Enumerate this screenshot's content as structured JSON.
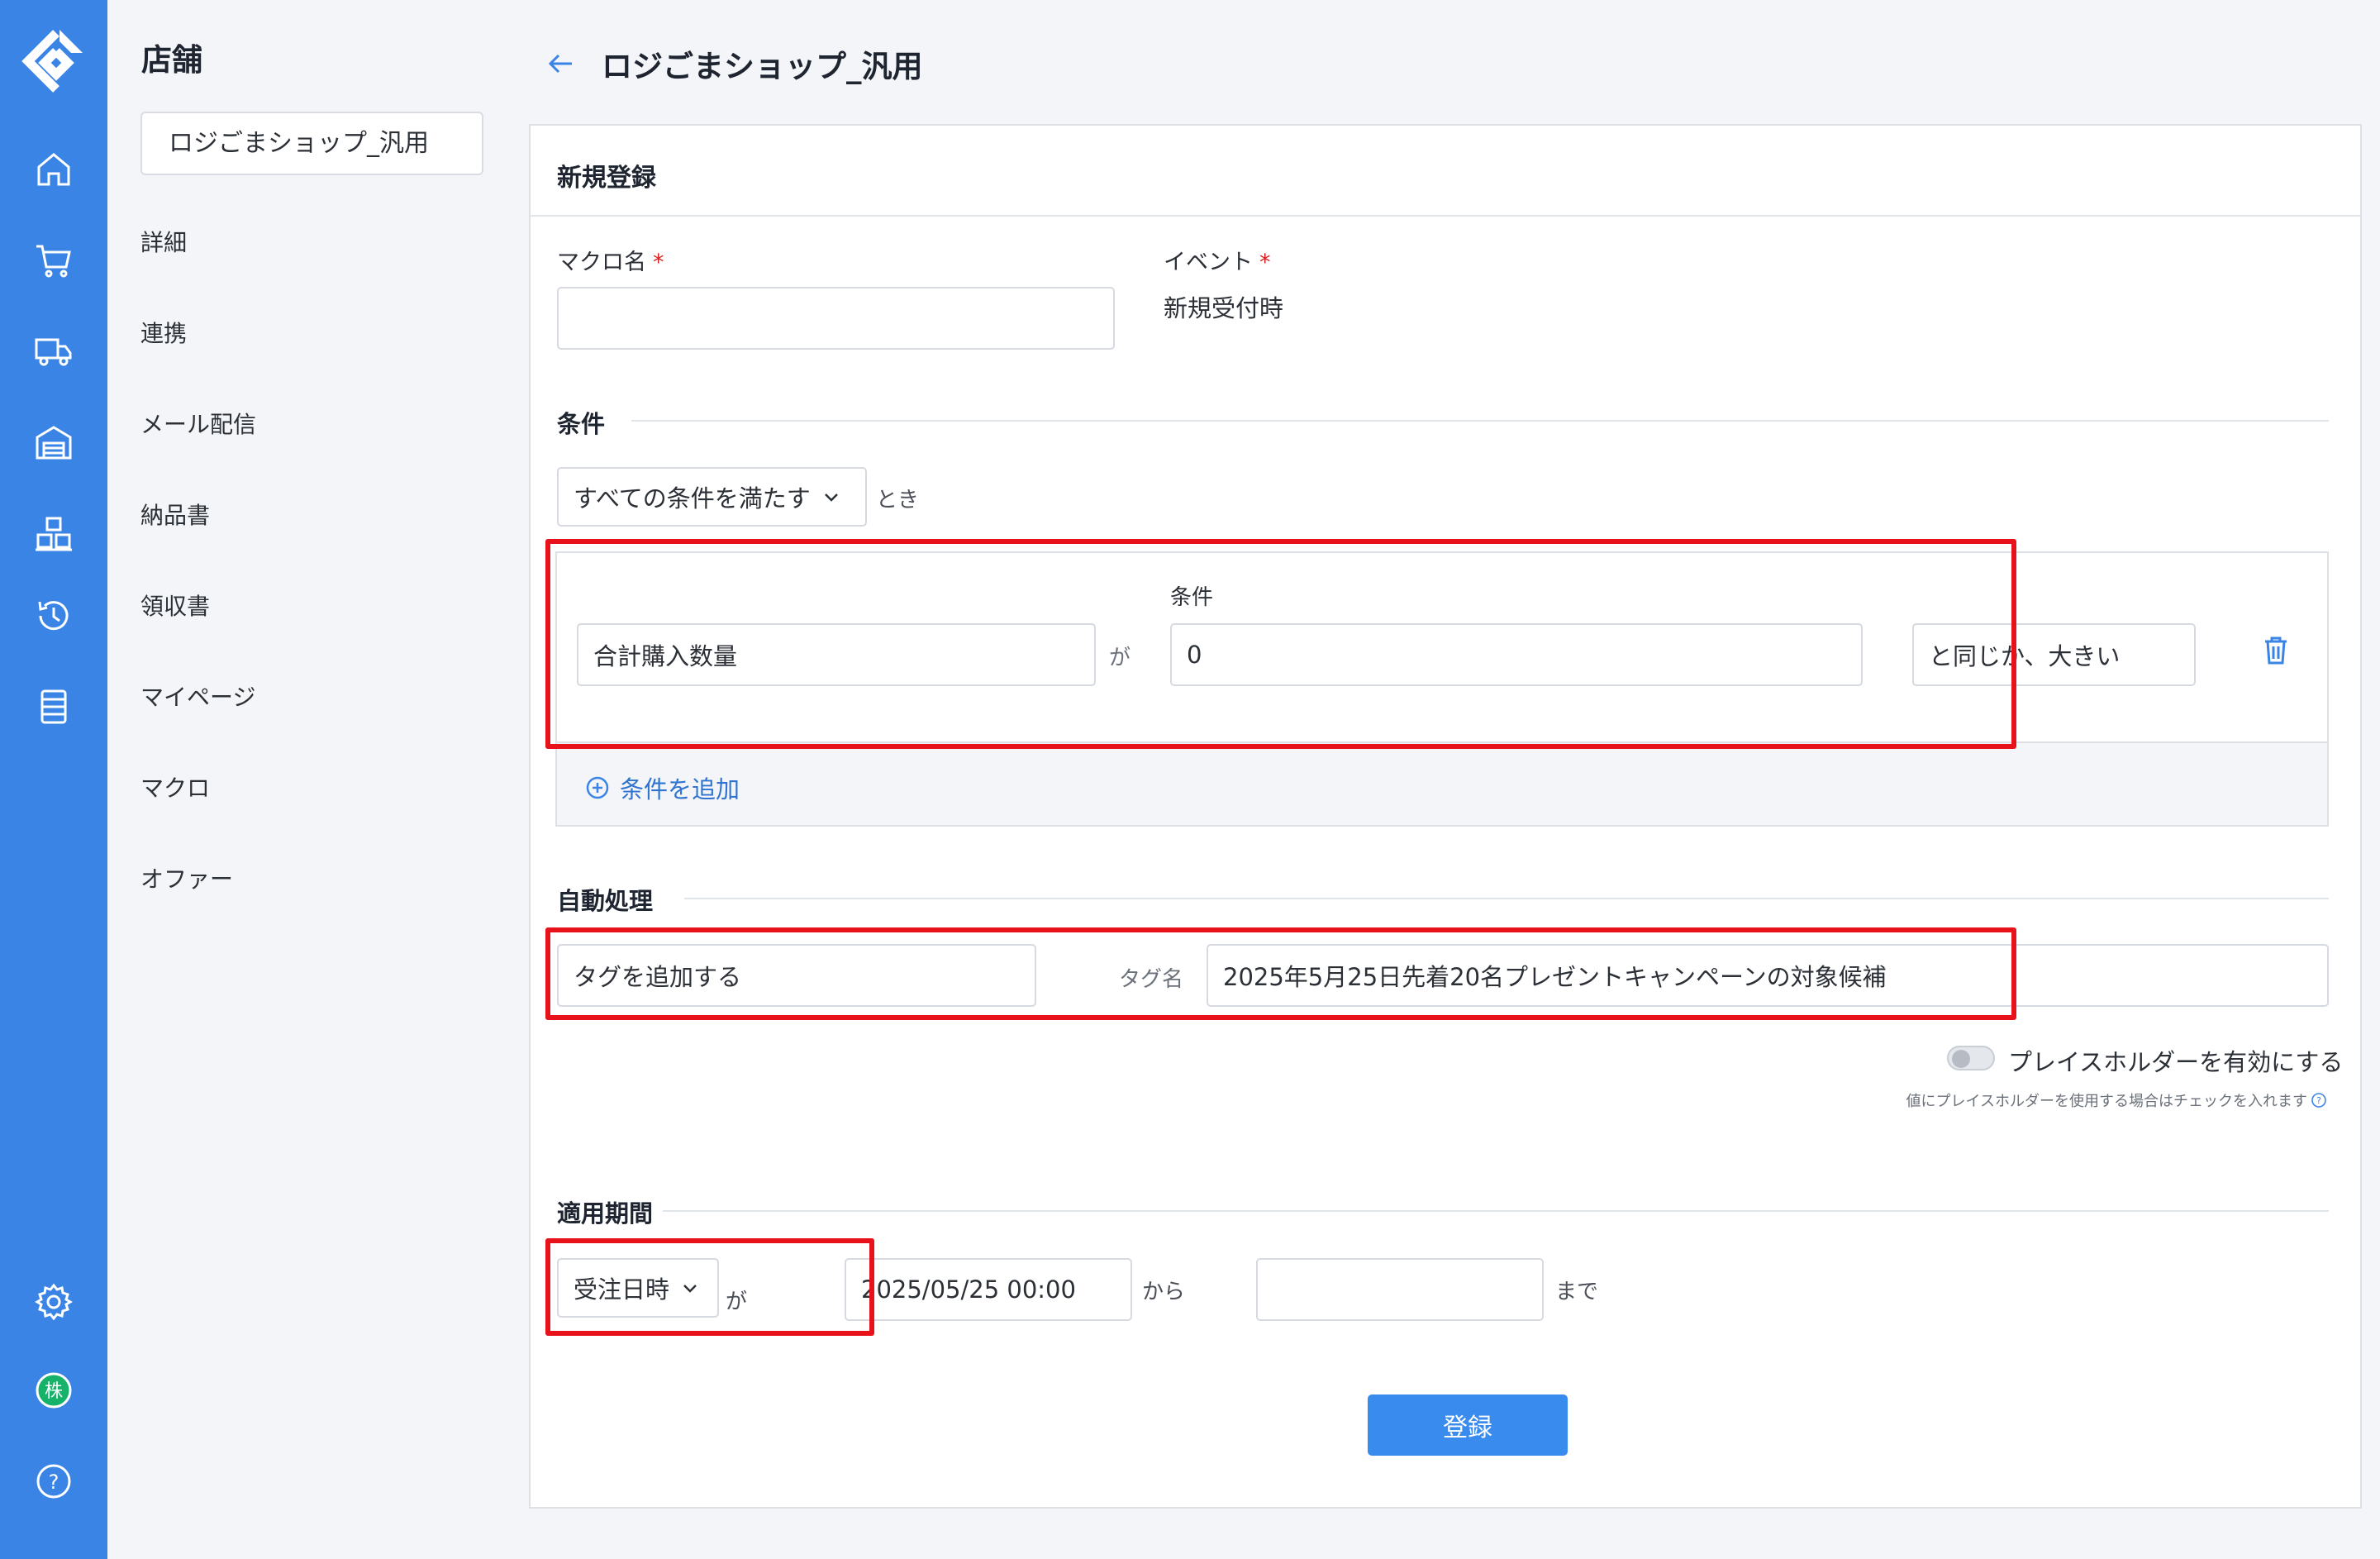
{
  "sidebar": {
    "title": "店舗",
    "store_value": "ロジごまショップ_汎用",
    "items": [
      {
        "label": "詳細"
      },
      {
        "label": "連携"
      },
      {
        "label": "メール配信"
      },
      {
        "label": "納品書"
      },
      {
        "label": "領収書"
      },
      {
        "label": "マイページ"
      },
      {
        "label": "マクロ"
      },
      {
        "label": "オファー"
      }
    ]
  },
  "rail": {
    "icons": [
      "home-icon",
      "cart-icon",
      "truck-icon",
      "warehouse-icon",
      "boxes-icon",
      "history-icon",
      "list-icon",
      "gear-icon",
      "company-icon",
      "help-icon"
    ],
    "company_badge": "株",
    "help_glyph": "?"
  },
  "header": {
    "title": "ロジごまショップ_汎用"
  },
  "form": {
    "card_title": "新規登録",
    "macro_name_label": "マクロ名",
    "macro_name_value": "",
    "required_mark": "*",
    "event_label": "イベント",
    "event_value": "新規受付時",
    "conditions": {
      "section_title": "条件",
      "match_select": "すべての条件を満たす",
      "match_suffix": "とき",
      "row": {
        "field": "合計購入数量",
        "ga": "が",
        "value_label": "条件",
        "value": "0",
        "operator": "と同じか、大きい"
      },
      "add_label": "条件を追加"
    },
    "auto_process": {
      "section_title": "自動処理",
      "action": "タグを追加する",
      "tag_label": "タグ名",
      "tag_value": "2025年5月25日先着20名プレゼントキャンペーンの対象候補",
      "placeholder_toggle_label": "プレイスホルダーを有効にする",
      "placeholder_toggle_on": false,
      "placeholder_help": "値にプレイスホルダーを使用する場合はチェックを入れます"
    },
    "period": {
      "section_title": "適用期間",
      "basis": "受注日時",
      "ga": "が",
      "from_value": "2025/05/25 00:00",
      "from_suffix": "から",
      "to_value": "",
      "to_suffix": "まで"
    },
    "submit_label": "登録"
  },
  "colors": {
    "rail": "#3a84e6",
    "primary": "#3a8bee",
    "highlight": "#e8121b",
    "company_badge": "#17b26a"
  }
}
